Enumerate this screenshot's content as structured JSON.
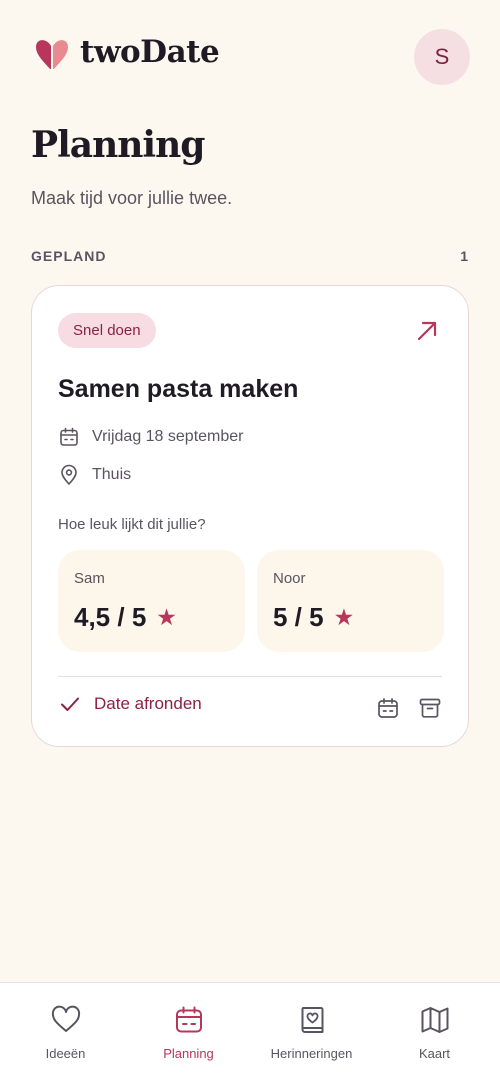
{
  "app": {
    "name": "twoDate"
  },
  "user": {
    "initial": "S"
  },
  "page": {
    "title": "Planning",
    "subtitle": "Maak tijd voor jullie twee."
  },
  "section": {
    "label": "GEPLAND",
    "count": "1"
  },
  "card": {
    "tag": "Snel doen",
    "title": "Samen pasta maken",
    "date": "Vrijdag 18 september",
    "location": "Thuis",
    "question": "Hoe leuk lijkt dit jullie?",
    "ratings": [
      {
        "name": "Sam",
        "score": "4,5 / 5"
      },
      {
        "name": "Noor",
        "score": "5 / 5"
      }
    ],
    "finish_label": "Date afronden"
  },
  "nav": {
    "items": [
      {
        "label": "Ideeën",
        "icon": "heart-icon"
      },
      {
        "label": "Planning",
        "icon": "calendar-icon",
        "active": true
      },
      {
        "label": "Herinneringen",
        "icon": "memory-book-icon"
      },
      {
        "label": "Kaart",
        "icon": "map-icon"
      }
    ]
  },
  "colors": {
    "background": "#fdf8ef",
    "accent": "#b8365a",
    "accent_dark": "#8b2145",
    "tag_bg": "#f7dde3",
    "rating_bg": "#fdf6ea"
  }
}
